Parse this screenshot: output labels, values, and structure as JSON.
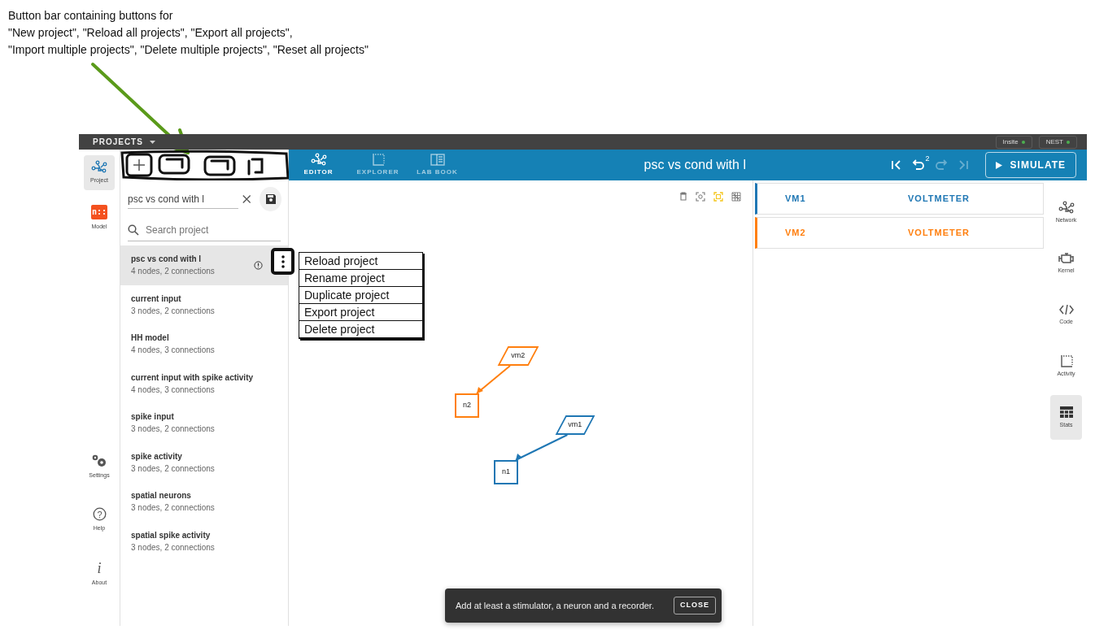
{
  "annotation": {
    "lines": [
      "Button bar containing buttons for",
      "\"New project\", \"Reload all projects\", \"Export all projects\",",
      "\"Import multiple projects\", \"Delete multiple projects\", \"Reset all projects\""
    ]
  },
  "top_bar": {
    "menu": "PROJECTS",
    "backends": [
      {
        "label": "Insite",
        "online": true
      },
      {
        "label": "NEST",
        "online": true
      }
    ]
  },
  "left_nav": [
    {
      "label": "Project",
      "kind": "network",
      "selected": true
    },
    {
      "label": "Model",
      "kind": "logo",
      "logo": "n::",
      "selected": false
    }
  ],
  "left_nav_bottom": [
    {
      "label": "Settings",
      "kind": "gears"
    },
    {
      "label": "Help",
      "kind": "help",
      "glyph": "?"
    },
    {
      "label": "About",
      "kind": "about",
      "glyph": "i"
    }
  ],
  "projects_panel": {
    "name_field": {
      "value": "psc vs cond with l"
    },
    "search": {
      "placeholder": "Search project"
    },
    "projects": [
      {
        "name": "psc vs cond with l",
        "info": "4 nodes, 2 connections",
        "selected": true
      },
      {
        "name": "current input",
        "info": "3 nodes, 2 connections",
        "selected": false
      },
      {
        "name": "HH model",
        "info": "4 nodes, 3 connections",
        "selected": false
      },
      {
        "name": "current input with spike activity",
        "info": "4 nodes, 3 connections",
        "selected": false
      },
      {
        "name": "spike input",
        "info": "3 nodes, 2 connections",
        "selected": false
      },
      {
        "name": "spike activity",
        "info": "3 nodes, 2 connections",
        "selected": false
      },
      {
        "name": "spatial neurons",
        "info": "3 nodes, 2 connections",
        "selected": false
      },
      {
        "name": "spatial spike activity",
        "info": "3 nodes, 2 connections",
        "selected": false
      }
    ]
  },
  "sketch_menu": [
    "Reload project",
    "Rename project",
    "Duplicate project",
    "Export project",
    "Delete project"
  ],
  "tabs": [
    {
      "label": "EDITOR",
      "kind": "network",
      "selected": true
    },
    {
      "label": "EXPLORER",
      "kind": "activity",
      "selected": false
    },
    {
      "label": "LAB BOOK",
      "kind": "book",
      "selected": false
    }
  ],
  "title": "psc vs cond with l",
  "history": {
    "undo_count": "2",
    "redo_disabled": true
  },
  "simulate": {
    "label": "SIMULATE"
  },
  "canvas": {
    "nodes": [
      {
        "label": "vm2",
        "kind": "recorder",
        "color": "#ff7f0e"
      },
      {
        "label": "n2",
        "kind": "neuron",
        "color": "#ff7f0e"
      },
      {
        "label": "vm1",
        "kind": "recorder",
        "color": "#1f77b4"
      },
      {
        "label": "n1",
        "kind": "neuron",
        "color": "#1f77b4"
      }
    ]
  },
  "stats": [
    {
      "label": "VM1",
      "model": "VOLTMETER",
      "color": "#1f77b4"
    },
    {
      "label": "VM2",
      "model": "VOLTMETER",
      "color": "#ff7f0e"
    }
  ],
  "right_nav": [
    {
      "label": "Network",
      "kind": "network",
      "selected": false
    },
    {
      "label": "Kernel",
      "kind": "kernel",
      "selected": false
    },
    {
      "label": "Code",
      "kind": "code",
      "selected": false
    },
    {
      "label": "Activity",
      "kind": "activity",
      "selected": false
    },
    {
      "label": "Stats",
      "kind": "table",
      "selected": true
    }
  ],
  "snackbar": {
    "message": "Add at least a stimulator, a neuron and a recorder.",
    "action": "CLOSE"
  }
}
